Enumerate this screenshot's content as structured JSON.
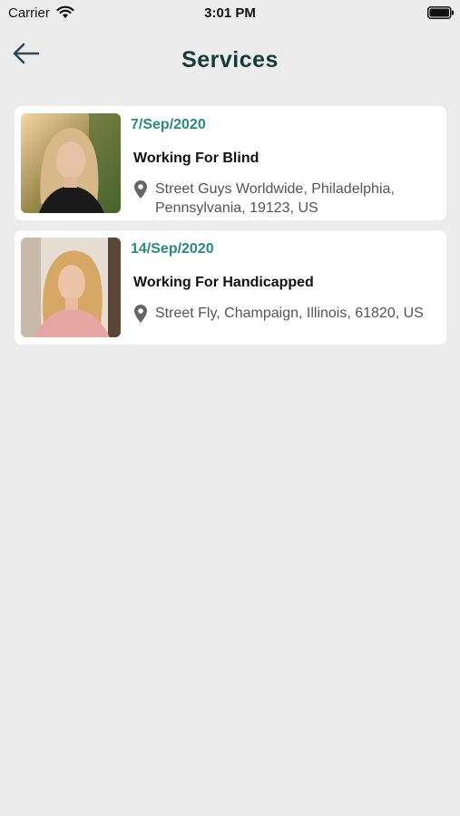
{
  "status_bar": {
    "carrier": "Carrier",
    "time": "3:01 PM"
  },
  "header": {
    "title": "Services",
    "back_icon": "arrow-left-icon"
  },
  "services": [
    {
      "date": "7/Sep/2020",
      "title": "Working For Blind",
      "address": "Street Guys Worldwide, Philadelphia, Pennsylvania, 19123, US",
      "icon": "location-pin-icon"
    },
    {
      "date": "14/Sep/2020",
      "title": "Working For Handicapped",
      "address": "Street Fly, Champaign, Illinois, 61820, US",
      "icon": "location-pin-icon"
    }
  ],
  "colors": {
    "background": "#ececec",
    "accent": "#2b8a78",
    "title": "#173b38",
    "card": "#ffffff"
  }
}
